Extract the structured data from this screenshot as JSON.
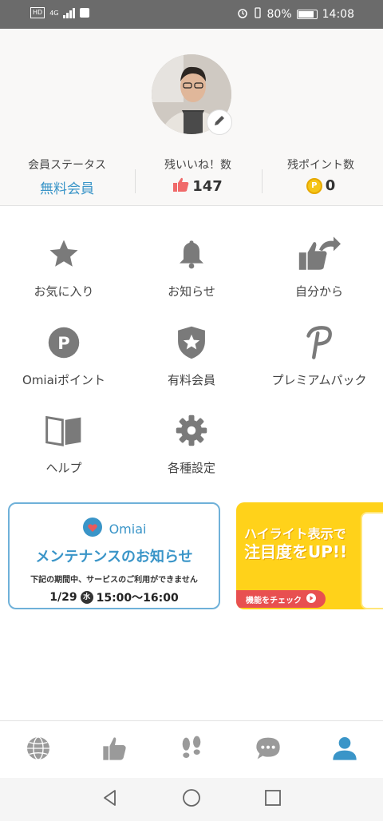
{
  "status_bar": {
    "hd": "HD",
    "network": "4G",
    "battery": "80%",
    "time": "14:08"
  },
  "profile": {
    "member_status_label": "会員ステータス",
    "member_status_value": "無料会員",
    "likes_label": "残いいね！数",
    "likes_value": "147",
    "points_label": "残ポイント数",
    "points_value": "0"
  },
  "menu": [
    {
      "label": "お気に入り",
      "icon": "star-icon"
    },
    {
      "label": "お知らせ",
      "icon": "bell-icon"
    },
    {
      "label": "自分から",
      "icon": "thumb-arrow-icon"
    },
    {
      "label": "Omiaiポイント",
      "icon": "points-icon"
    },
    {
      "label": "有料会員",
      "icon": "shield-star-icon"
    },
    {
      "label": "プレミアムパック",
      "icon": "premium-p-icon"
    },
    {
      "label": "ヘルプ",
      "icon": "book-icon"
    },
    {
      "label": "各種設定",
      "icon": "gear-icon"
    }
  ],
  "banner_maintenance": {
    "brand": "Omiai",
    "title": "メンテナンスのお知らせ",
    "subtitle": "下記の期間中、サービスのご利用ができません",
    "date": "1/29",
    "weekday": "水",
    "time": "15:00〜16:00"
  },
  "banner_highlight": {
    "line1": "ハイライト表示で",
    "line2": "注目度をUP!!",
    "button": "機能をチェック"
  },
  "tabs": [
    {
      "icon": "globe-icon"
    },
    {
      "icon": "thumbs-up-icon"
    },
    {
      "icon": "footprints-icon"
    },
    {
      "icon": "chat-icon"
    },
    {
      "icon": "person-icon",
      "active": true
    }
  ],
  "colors": {
    "accent": "#3a95c8",
    "like": "#f06a6a",
    "coin": "#f5c518",
    "icon_gray": "#7a7a7a"
  }
}
